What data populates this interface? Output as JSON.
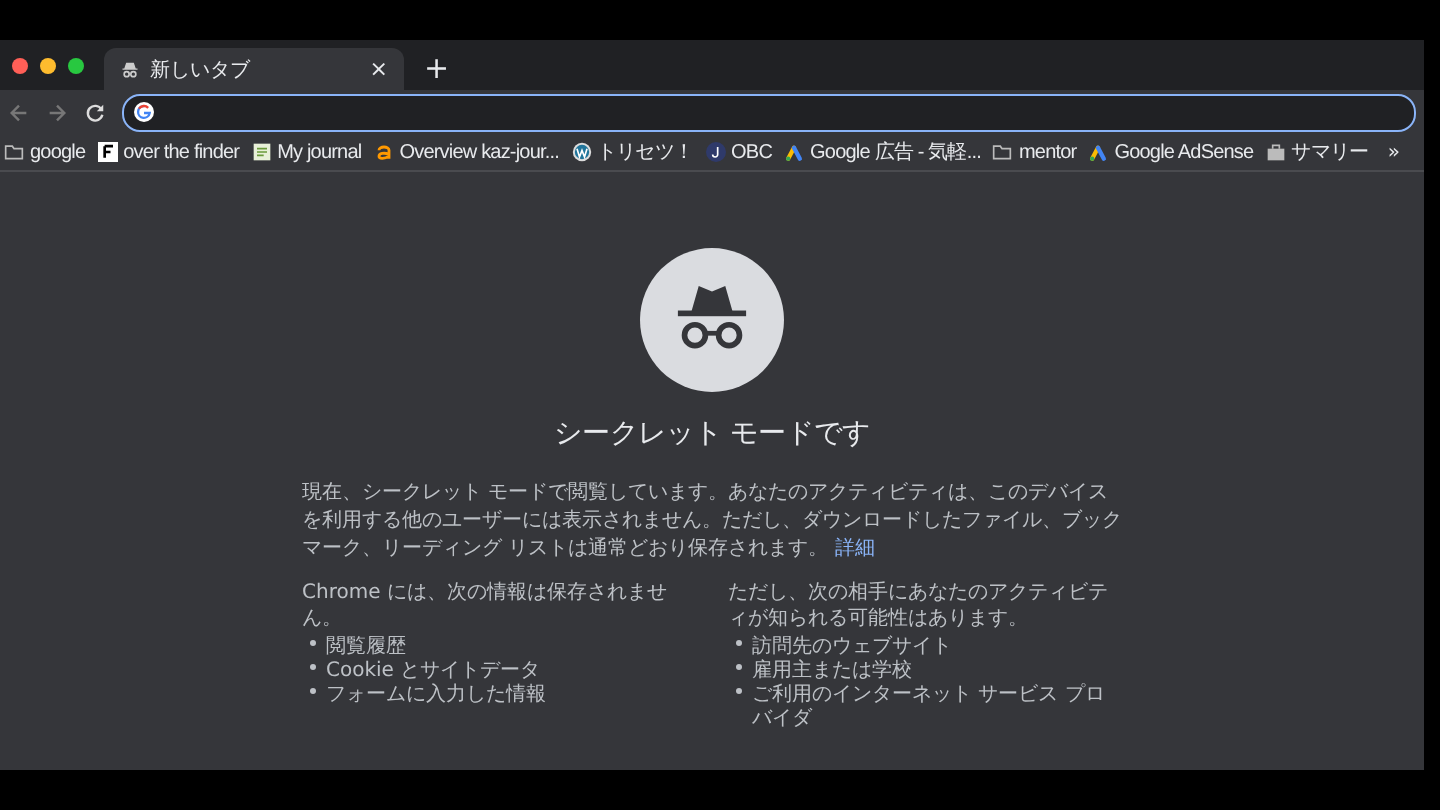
{
  "tab": {
    "title": "新しいタブ",
    "close": "×",
    "new_tab": "+"
  },
  "bookmarks": [
    {
      "label": "google",
      "kind": "folder"
    },
    {
      "label": "over the finder",
      "kind": "letter"
    },
    {
      "label": "My journal",
      "kind": "page"
    },
    {
      "label": "Overview kaz-jour...",
      "kind": "amazon"
    },
    {
      "label": "トリセツ！",
      "kind": "wordpress"
    },
    {
      "label": "OBC",
      "kind": "circle"
    },
    {
      "label": "Google 広告 - 気軽...",
      "kind": "ads"
    },
    {
      "label": "mentor",
      "kind": "folder"
    },
    {
      "label": "Google AdSense",
      "kind": "adsense"
    },
    {
      "label": "サマリー",
      "kind": "briefcase"
    }
  ],
  "bookmarks_more": "»",
  "incognito": {
    "heading": "シークレット モードです",
    "intro": "現在、シークレット モードで閲覧しています。あなたのアクティビティは、このデバイスを利用する他のユーザーには表示されません。ただし、ダウンロードしたファイル、ブックマーク、リーディング リストは通常どおり保存されます。",
    "link": "詳細",
    "not_saved": {
      "title": "Chrome には、次の情報は保存されません。",
      "items": [
        "閲覧履歴",
        "Cookie とサイトデータ",
        "フォームに入力した情報"
      ]
    },
    "visible_to": {
      "title": "ただし、次の相手にあなたのアクティビティが知られる可能性はあります。",
      "items": [
        "訪問先のウェブサイト",
        "雇用主または学校",
        "ご利用のインターネット サービス プロバイダ"
      ]
    }
  }
}
